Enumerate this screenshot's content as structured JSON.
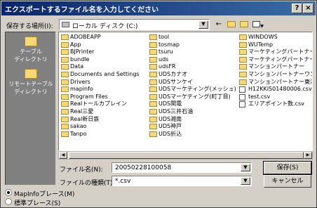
{
  "window": {
    "title": "エクスポートするファイル名を入力してください"
  },
  "titlebar_buttons": {
    "help": "?",
    "close": "×"
  },
  "lookin": {
    "label": "保存する場所(I):",
    "value": "ローカル ディスク (C:)"
  },
  "places": [
    {
      "label_line1": "テーブル",
      "label_line2": "ディレクトリ"
    },
    {
      "label_line1": "リモートテーブル",
      "label_line2": "ディレクトリ"
    }
  ],
  "files": {
    "col1": [
      {
        "name": "ADOBEAPP",
        "type": "folder"
      },
      {
        "name": "App",
        "type": "folder"
      },
      {
        "name": "BJPrinter",
        "type": "folder"
      },
      {
        "name": "bundle",
        "type": "folder"
      },
      {
        "name": "Data",
        "type": "folder"
      },
      {
        "name": "Documents and Settings",
        "type": "folder"
      },
      {
        "name": "Drivers",
        "type": "folder"
      },
      {
        "name": "mapinfo",
        "type": "folder"
      },
      {
        "name": "Program Files",
        "type": "folder"
      },
      {
        "name": "Realトールカプレイン",
        "type": "folder"
      },
      {
        "name": "Real三愛",
        "type": "folder"
      },
      {
        "name": "Real新日鉄",
        "type": "folder"
      },
      {
        "name": "sakao",
        "type": "folder"
      },
      {
        "name": "Tanpo",
        "type": "folder"
      }
    ],
    "col2": [
      {
        "name": "tool",
        "type": "folder"
      },
      {
        "name": "tosmap",
        "type": "folder"
      },
      {
        "name": "tsuru",
        "type": "folder"
      },
      {
        "name": "uds",
        "type": "folder"
      },
      {
        "name": "udsFR",
        "type": "folder"
      },
      {
        "name": "UDSカナオ",
        "type": "folder"
      },
      {
        "name": "UDSサンケイ",
        "type": "folder"
      },
      {
        "name": "UDSマーケティング(メッシュ)",
        "type": "folder"
      },
      {
        "name": "UDSマーケティング(町丁目)",
        "type": "folder"
      },
      {
        "name": "UDS関電",
        "type": "folder"
      },
      {
        "name": "UDS三井石油",
        "type": "folder"
      },
      {
        "name": "UDS湘南",
        "type": "folder"
      },
      {
        "name": "UDS神戸",
        "type": "folder"
      },
      {
        "name": "UDS折込",
        "type": "folder"
      }
    ],
    "col3": [
      {
        "name": "WINDOWS",
        "type": "folder"
      },
      {
        "name": "WUTemp",
        "type": "folder"
      },
      {
        "name": "マーケティングパートナーエル",
        "type": "folder"
      },
      {
        "name": "マーケティングパートナー三菱",
        "type": "folder"
      },
      {
        "name": "マンションパートナー",
        "type": "folder"
      },
      {
        "name": "マンションパートナーワンダー",
        "type": "folder"
      },
      {
        "name": "マンションパートナー東洋",
        "type": "folder"
      },
      {
        "name": "H12KKIS01480006.csv",
        "type": "file"
      },
      {
        "name": "test.csv",
        "type": "file"
      },
      {
        "name": "エリアポイント数.csv",
        "type": "file"
      }
    ]
  },
  "filename": {
    "label": "ファイル名(N):",
    "value": "20050228100058"
  },
  "filetype": {
    "label": "ファイルの種類(T):",
    "value": "*.csv"
  },
  "buttons": {
    "save": "保存(S)",
    "cancel": "キャンセル"
  },
  "radios": [
    {
      "label": "MapInfoプレース(M)",
      "checked": true
    },
    {
      "label": "標準プレース(S)",
      "checked": false
    }
  ]
}
